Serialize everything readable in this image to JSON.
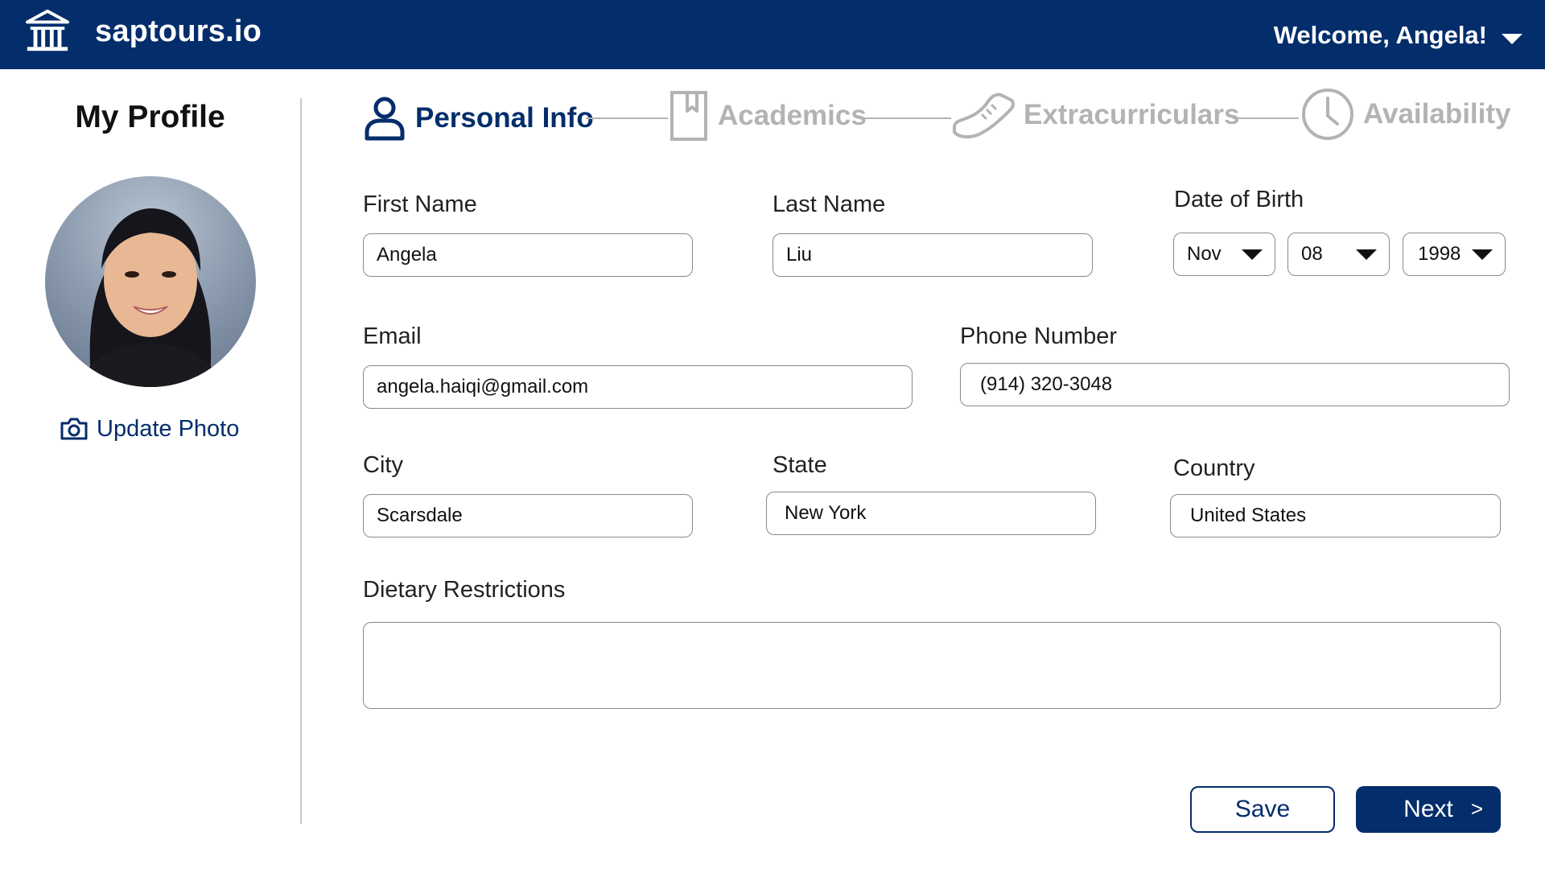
{
  "header": {
    "brand": "saptours.io",
    "welcome": "Welcome, Angela!",
    "logo_icon": "institution-building-icon",
    "menu_icon": "caret-down-icon",
    "background_color": "#032d6b"
  },
  "sidebar": {
    "title": "My Profile",
    "update_photo_label": "Update Photo",
    "update_photo_icon": "camera-icon"
  },
  "steps": [
    {
      "label": "Personal Info",
      "icon": "user-icon",
      "state": "active"
    },
    {
      "label": "Academics",
      "icon": "notebook-icon",
      "state": "inactive"
    },
    {
      "label": "Extracurriculars",
      "icon": "sneaker-icon",
      "state": "inactive"
    },
    {
      "label": "Availability",
      "icon": "clock-icon",
      "state": "inactive"
    }
  ],
  "form": {
    "first_name": {
      "label": "First Name",
      "value": "Angela"
    },
    "last_name": {
      "label": "Last Name",
      "value": "Liu"
    },
    "dob": {
      "label": "Date of Birth",
      "month": "Nov",
      "day": "08",
      "year": "1998"
    },
    "email": {
      "label": "Email",
      "value": "angela.haiqi@gmail.com"
    },
    "phone": {
      "label": "Phone Number",
      "value": "(914) 320-3048"
    },
    "city": {
      "label": "City",
      "value": "Scarsdale"
    },
    "state": {
      "label": "State",
      "value": "New York"
    },
    "country": {
      "label": "Country",
      "value": "United States"
    },
    "dietary": {
      "label": "Dietary Restrictions",
      "value": ""
    }
  },
  "actions": {
    "save_label": "Save",
    "next_label": "Next",
    "next_arrow": ">"
  },
  "colors": {
    "primary": "#032d6b",
    "inactive_step": "#b3b3b3",
    "field_border": "#8a8a8a"
  }
}
